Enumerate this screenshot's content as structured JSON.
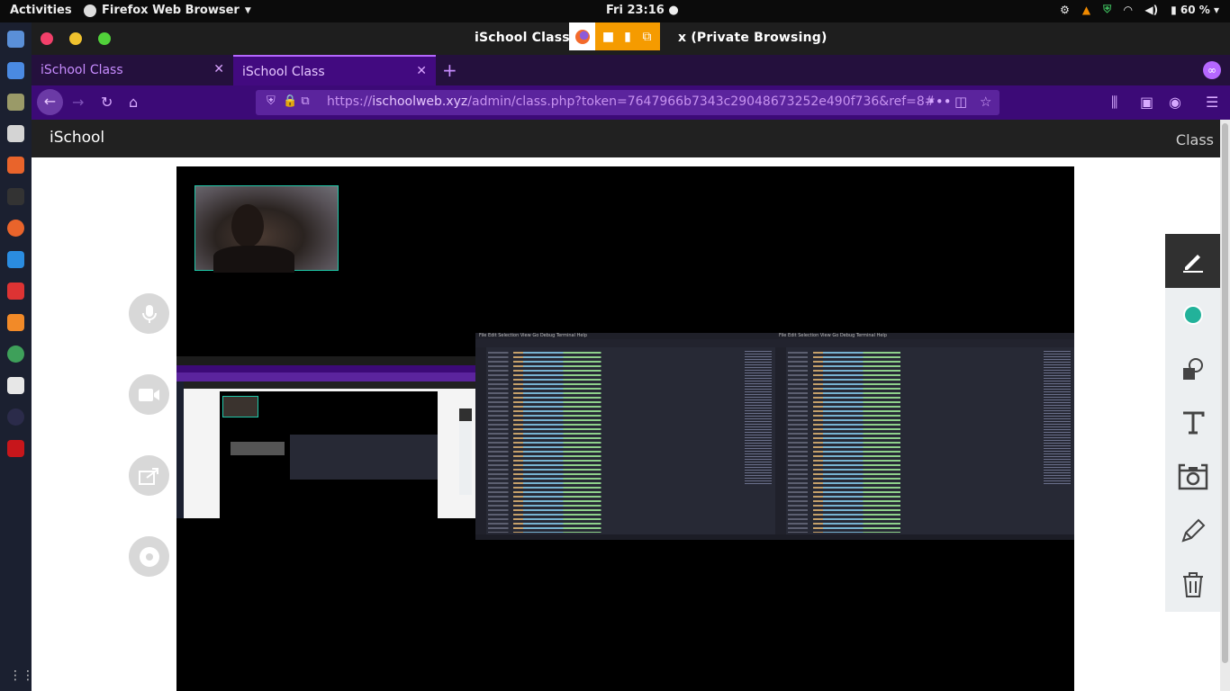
{
  "topbar": {
    "activities": "Activities",
    "app_name": "Firefox Web Browser",
    "clock": "Fri 23:16",
    "battery": "60 %"
  },
  "window": {
    "title_left": "iSchool Class - ",
    "title_right": "x (Private Browsing)"
  },
  "tabs": [
    {
      "label": "iSchool Class"
    },
    {
      "label": "iSchool Class"
    }
  ],
  "url": {
    "scheme": "https://",
    "domain": "ischoolweb.xyz",
    "path": "/admin/class.php?token=7647966b7343c29048673252e490f736&ref=8#"
  },
  "site": {
    "brand": "iSchool",
    "nav_class": "Class"
  },
  "shared_code": {
    "menu": "File  Edit  Selection  View  Go  Debug  Terminal  Help"
  }
}
